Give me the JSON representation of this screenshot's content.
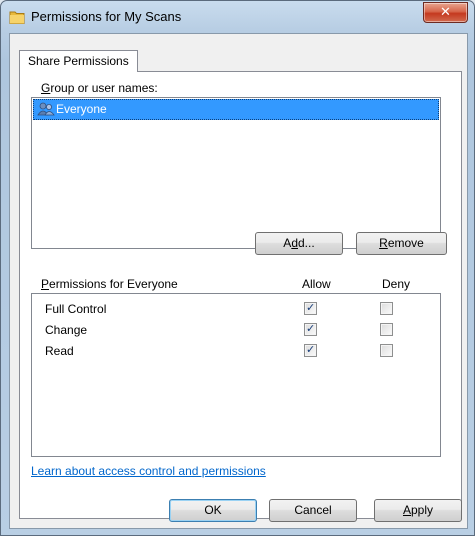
{
  "window": {
    "title": "Permissions for My Scans",
    "close_label": "✕"
  },
  "tabs": [
    {
      "label": "Share Permissions",
      "selected": true
    }
  ],
  "group_section": {
    "label_first": "G",
    "label_rest": "roup or user names:",
    "items": [
      {
        "name": "Everyone",
        "selected": true,
        "icon": "users-icon"
      }
    ]
  },
  "buttons": {
    "add_pre": "A",
    "add_ul": "d",
    "add_post": "d...",
    "remove_ul": "R",
    "remove_post": "emove",
    "ok": "OK",
    "cancel": "Cancel",
    "apply_ul": "A",
    "apply_post": "pply"
  },
  "permissions": {
    "header_ul": "P",
    "header_rest": "ermissions for Everyone",
    "col_allow": "Allow",
    "col_deny": "Deny",
    "rows": [
      {
        "name": "Full Control",
        "allow": true,
        "deny": false
      },
      {
        "name": "Change",
        "allow": true,
        "deny": false
      },
      {
        "name": "Read",
        "allow": true,
        "deny": false
      }
    ]
  },
  "help_link": "Learn about access control and permissions",
  "colors": {
    "selection": "#3399ff",
    "link": "#0066cc",
    "close_button": "#c4391f"
  }
}
